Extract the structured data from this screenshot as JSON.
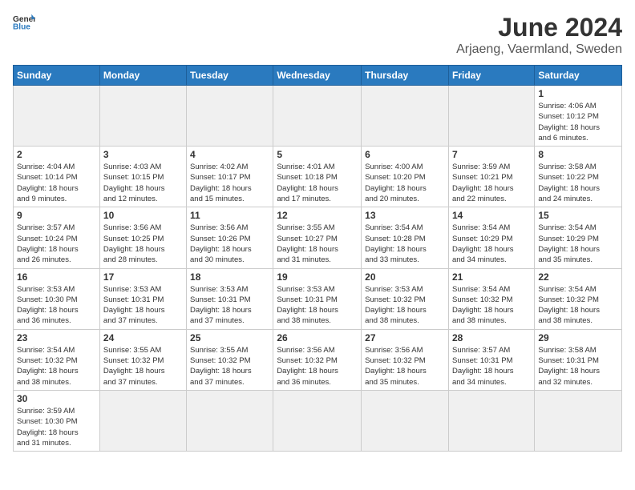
{
  "logo": {
    "text_general": "General",
    "text_blue": "Blue"
  },
  "header": {
    "month_year": "June 2024",
    "location": "Arjaeng, Vaermland, Sweden"
  },
  "days_of_week": [
    "Sunday",
    "Monday",
    "Tuesday",
    "Wednesday",
    "Thursday",
    "Friday",
    "Saturday"
  ],
  "weeks": [
    [
      {
        "day": "",
        "info": ""
      },
      {
        "day": "",
        "info": ""
      },
      {
        "day": "",
        "info": ""
      },
      {
        "day": "",
        "info": ""
      },
      {
        "day": "",
        "info": ""
      },
      {
        "day": "",
        "info": ""
      },
      {
        "day": "1",
        "info": "Sunrise: 4:06 AM\nSunset: 10:12 PM\nDaylight: 18 hours\nand 6 minutes."
      }
    ],
    [
      {
        "day": "2",
        "info": "Sunrise: 4:04 AM\nSunset: 10:14 PM\nDaylight: 18 hours\nand 9 minutes."
      },
      {
        "day": "3",
        "info": "Sunrise: 4:03 AM\nSunset: 10:15 PM\nDaylight: 18 hours\nand 12 minutes."
      },
      {
        "day": "4",
        "info": "Sunrise: 4:02 AM\nSunset: 10:17 PM\nDaylight: 18 hours\nand 15 minutes."
      },
      {
        "day": "5",
        "info": "Sunrise: 4:01 AM\nSunset: 10:18 PM\nDaylight: 18 hours\nand 17 minutes."
      },
      {
        "day": "6",
        "info": "Sunrise: 4:00 AM\nSunset: 10:20 PM\nDaylight: 18 hours\nand 20 minutes."
      },
      {
        "day": "7",
        "info": "Sunrise: 3:59 AM\nSunset: 10:21 PM\nDaylight: 18 hours\nand 22 minutes."
      },
      {
        "day": "8",
        "info": "Sunrise: 3:58 AM\nSunset: 10:22 PM\nDaylight: 18 hours\nand 24 minutes."
      }
    ],
    [
      {
        "day": "9",
        "info": "Sunrise: 3:57 AM\nSunset: 10:24 PM\nDaylight: 18 hours\nand 26 minutes."
      },
      {
        "day": "10",
        "info": "Sunrise: 3:56 AM\nSunset: 10:25 PM\nDaylight: 18 hours\nand 28 minutes."
      },
      {
        "day": "11",
        "info": "Sunrise: 3:56 AM\nSunset: 10:26 PM\nDaylight: 18 hours\nand 30 minutes."
      },
      {
        "day": "12",
        "info": "Sunrise: 3:55 AM\nSunset: 10:27 PM\nDaylight: 18 hours\nand 31 minutes."
      },
      {
        "day": "13",
        "info": "Sunrise: 3:54 AM\nSunset: 10:28 PM\nDaylight: 18 hours\nand 33 minutes."
      },
      {
        "day": "14",
        "info": "Sunrise: 3:54 AM\nSunset: 10:29 PM\nDaylight: 18 hours\nand 34 minutes."
      },
      {
        "day": "15",
        "info": "Sunrise: 3:54 AM\nSunset: 10:29 PM\nDaylight: 18 hours\nand 35 minutes."
      }
    ],
    [
      {
        "day": "16",
        "info": "Sunrise: 3:53 AM\nSunset: 10:30 PM\nDaylight: 18 hours\nand 36 minutes."
      },
      {
        "day": "17",
        "info": "Sunrise: 3:53 AM\nSunset: 10:31 PM\nDaylight: 18 hours\nand 37 minutes."
      },
      {
        "day": "18",
        "info": "Sunrise: 3:53 AM\nSunset: 10:31 PM\nDaylight: 18 hours\nand 37 minutes."
      },
      {
        "day": "19",
        "info": "Sunrise: 3:53 AM\nSunset: 10:31 PM\nDaylight: 18 hours\nand 38 minutes."
      },
      {
        "day": "20",
        "info": "Sunrise: 3:53 AM\nSunset: 10:32 PM\nDaylight: 18 hours\nand 38 minutes."
      },
      {
        "day": "21",
        "info": "Sunrise: 3:54 AM\nSunset: 10:32 PM\nDaylight: 18 hours\nand 38 minutes."
      },
      {
        "day": "22",
        "info": "Sunrise: 3:54 AM\nSunset: 10:32 PM\nDaylight: 18 hours\nand 38 minutes."
      }
    ],
    [
      {
        "day": "23",
        "info": "Sunrise: 3:54 AM\nSunset: 10:32 PM\nDaylight: 18 hours\nand 38 minutes."
      },
      {
        "day": "24",
        "info": "Sunrise: 3:55 AM\nSunset: 10:32 PM\nDaylight: 18 hours\nand 37 minutes."
      },
      {
        "day": "25",
        "info": "Sunrise: 3:55 AM\nSunset: 10:32 PM\nDaylight: 18 hours\nand 37 minutes."
      },
      {
        "day": "26",
        "info": "Sunrise: 3:56 AM\nSunset: 10:32 PM\nDaylight: 18 hours\nand 36 minutes."
      },
      {
        "day": "27",
        "info": "Sunrise: 3:56 AM\nSunset: 10:32 PM\nDaylight: 18 hours\nand 35 minutes."
      },
      {
        "day": "28",
        "info": "Sunrise: 3:57 AM\nSunset: 10:31 PM\nDaylight: 18 hours\nand 34 minutes."
      },
      {
        "day": "29",
        "info": "Sunrise: 3:58 AM\nSunset: 10:31 PM\nDaylight: 18 hours\nand 32 minutes."
      }
    ],
    [
      {
        "day": "30",
        "info": "Sunrise: 3:59 AM\nSunset: 10:30 PM\nDaylight: 18 hours\nand 31 minutes."
      },
      {
        "day": "",
        "info": ""
      },
      {
        "day": "",
        "info": ""
      },
      {
        "day": "",
        "info": ""
      },
      {
        "day": "",
        "info": ""
      },
      {
        "day": "",
        "info": ""
      },
      {
        "day": "",
        "info": ""
      }
    ]
  ]
}
